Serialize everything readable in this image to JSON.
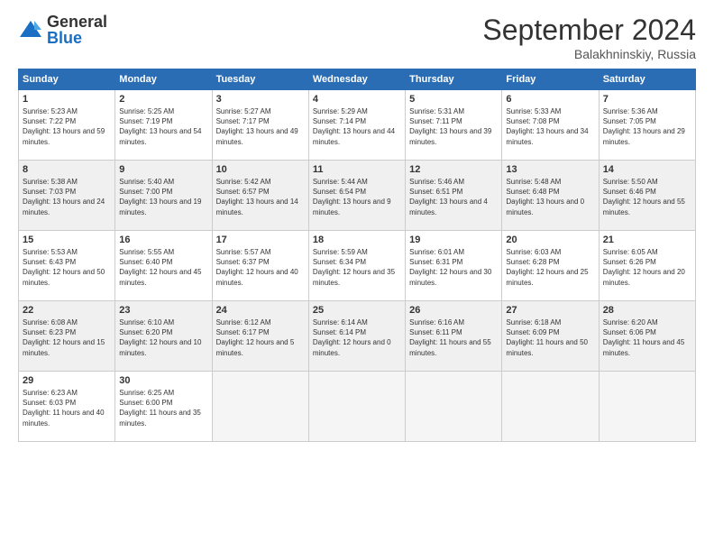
{
  "logo": {
    "general": "General",
    "blue": "Blue"
  },
  "header": {
    "month": "September 2024",
    "location": "Balakhninskiy, Russia"
  },
  "weekdays": [
    "Sunday",
    "Monday",
    "Tuesday",
    "Wednesday",
    "Thursday",
    "Friday",
    "Saturday"
  ],
  "weeks": [
    [
      {
        "day": "1",
        "sunrise": "5:23 AM",
        "sunset": "7:22 PM",
        "daylight": "13 hours and 59 minutes."
      },
      {
        "day": "2",
        "sunrise": "5:25 AM",
        "sunset": "7:19 PM",
        "daylight": "13 hours and 54 minutes."
      },
      {
        "day": "3",
        "sunrise": "5:27 AM",
        "sunset": "7:17 PM",
        "daylight": "13 hours and 49 minutes."
      },
      {
        "day": "4",
        "sunrise": "5:29 AM",
        "sunset": "7:14 PM",
        "daylight": "13 hours and 44 minutes."
      },
      {
        "day": "5",
        "sunrise": "5:31 AM",
        "sunset": "7:11 PM",
        "daylight": "13 hours and 39 minutes."
      },
      {
        "day": "6",
        "sunrise": "5:33 AM",
        "sunset": "7:08 PM",
        "daylight": "13 hours and 34 minutes."
      },
      {
        "day": "7",
        "sunrise": "5:36 AM",
        "sunset": "7:05 PM",
        "daylight": "13 hours and 29 minutes."
      }
    ],
    [
      {
        "day": "8",
        "sunrise": "5:38 AM",
        "sunset": "7:03 PM",
        "daylight": "13 hours and 24 minutes."
      },
      {
        "day": "9",
        "sunrise": "5:40 AM",
        "sunset": "7:00 PM",
        "daylight": "13 hours and 19 minutes."
      },
      {
        "day": "10",
        "sunrise": "5:42 AM",
        "sunset": "6:57 PM",
        "daylight": "13 hours and 14 minutes."
      },
      {
        "day": "11",
        "sunrise": "5:44 AM",
        "sunset": "6:54 PM",
        "daylight": "13 hours and 9 minutes."
      },
      {
        "day": "12",
        "sunrise": "5:46 AM",
        "sunset": "6:51 PM",
        "daylight": "13 hours and 4 minutes."
      },
      {
        "day": "13",
        "sunrise": "5:48 AM",
        "sunset": "6:48 PM",
        "daylight": "13 hours and 0 minutes."
      },
      {
        "day": "14",
        "sunrise": "5:50 AM",
        "sunset": "6:46 PM",
        "daylight": "12 hours and 55 minutes."
      }
    ],
    [
      {
        "day": "15",
        "sunrise": "5:53 AM",
        "sunset": "6:43 PM",
        "daylight": "12 hours and 50 minutes."
      },
      {
        "day": "16",
        "sunrise": "5:55 AM",
        "sunset": "6:40 PM",
        "daylight": "12 hours and 45 minutes."
      },
      {
        "day": "17",
        "sunrise": "5:57 AM",
        "sunset": "6:37 PM",
        "daylight": "12 hours and 40 minutes."
      },
      {
        "day": "18",
        "sunrise": "5:59 AM",
        "sunset": "6:34 PM",
        "daylight": "12 hours and 35 minutes."
      },
      {
        "day": "19",
        "sunrise": "6:01 AM",
        "sunset": "6:31 PM",
        "daylight": "12 hours and 30 minutes."
      },
      {
        "day": "20",
        "sunrise": "6:03 AM",
        "sunset": "6:28 PM",
        "daylight": "12 hours and 25 minutes."
      },
      {
        "day": "21",
        "sunrise": "6:05 AM",
        "sunset": "6:26 PM",
        "daylight": "12 hours and 20 minutes."
      }
    ],
    [
      {
        "day": "22",
        "sunrise": "6:08 AM",
        "sunset": "6:23 PM",
        "daylight": "12 hours and 15 minutes."
      },
      {
        "day": "23",
        "sunrise": "6:10 AM",
        "sunset": "6:20 PM",
        "daylight": "12 hours and 10 minutes."
      },
      {
        "day": "24",
        "sunrise": "6:12 AM",
        "sunset": "6:17 PM",
        "daylight": "12 hours and 5 minutes."
      },
      {
        "day": "25",
        "sunrise": "6:14 AM",
        "sunset": "6:14 PM",
        "daylight": "12 hours and 0 minutes."
      },
      {
        "day": "26",
        "sunrise": "6:16 AM",
        "sunset": "6:11 PM",
        "daylight": "11 hours and 55 minutes."
      },
      {
        "day": "27",
        "sunrise": "6:18 AM",
        "sunset": "6:09 PM",
        "daylight": "11 hours and 50 minutes."
      },
      {
        "day": "28",
        "sunrise": "6:20 AM",
        "sunset": "6:06 PM",
        "daylight": "11 hours and 45 minutes."
      }
    ],
    [
      {
        "day": "29",
        "sunrise": "6:23 AM",
        "sunset": "6:03 PM",
        "daylight": "11 hours and 40 minutes."
      },
      {
        "day": "30",
        "sunrise": "6:25 AM",
        "sunset": "6:00 PM",
        "daylight": "11 hours and 35 minutes."
      },
      null,
      null,
      null,
      null,
      null
    ]
  ]
}
